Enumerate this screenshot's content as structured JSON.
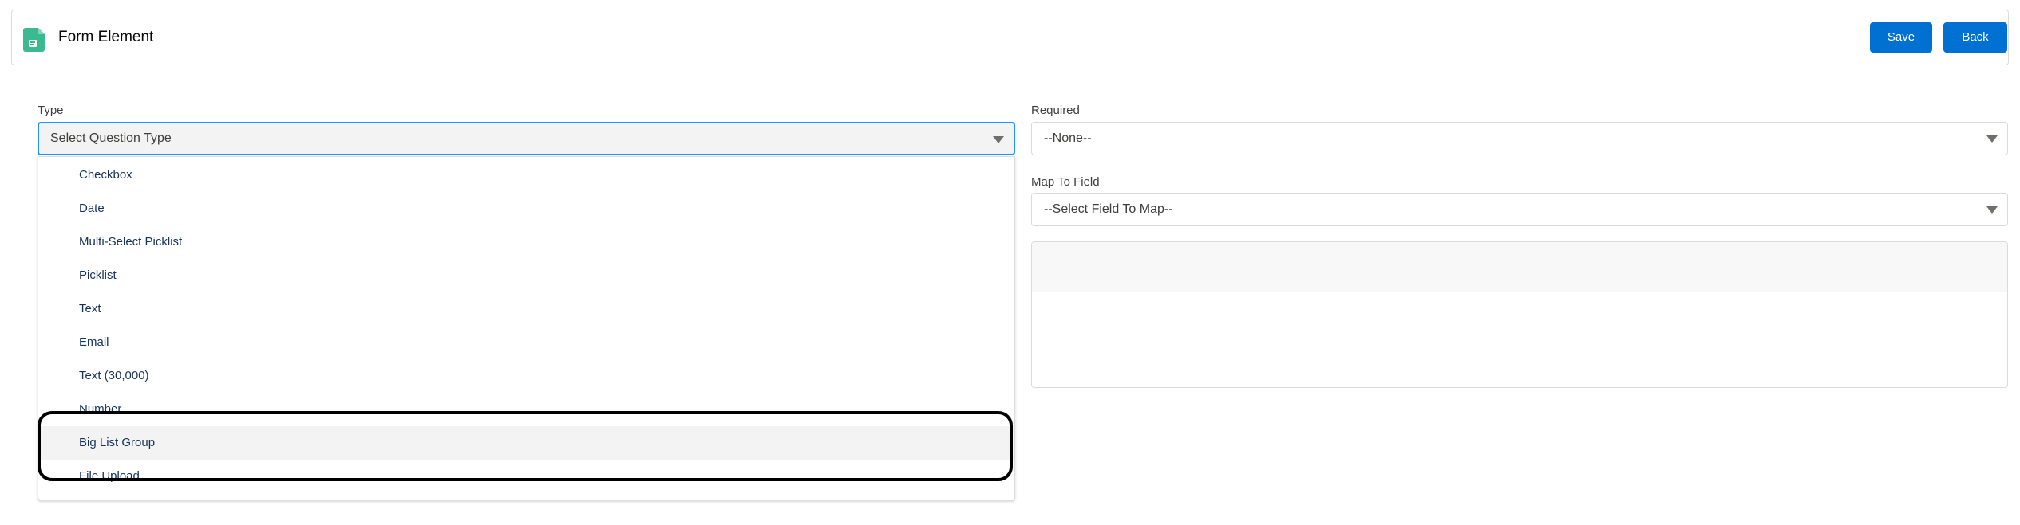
{
  "header": {
    "title": "Form Element",
    "icon": "form-document-icon",
    "icon_color": "#3bba8f",
    "save_label": "Save",
    "back_label": "Back",
    "button_color": "#0070d2"
  },
  "type_field": {
    "label": "Type",
    "value": "Select Question Type",
    "options": [
      "Checkbox",
      "Date",
      "Multi-Select Picklist",
      "Picklist",
      "Text",
      "Email",
      "Text (30,000)",
      "Number",
      "Big List Group",
      "File Upload"
    ],
    "highlighted_option": "Big List Group"
  },
  "required_field": {
    "label": "Required",
    "value": "--None--"
  },
  "map_field": {
    "label": "Map To Field",
    "value": "--Select Field To Map--"
  }
}
